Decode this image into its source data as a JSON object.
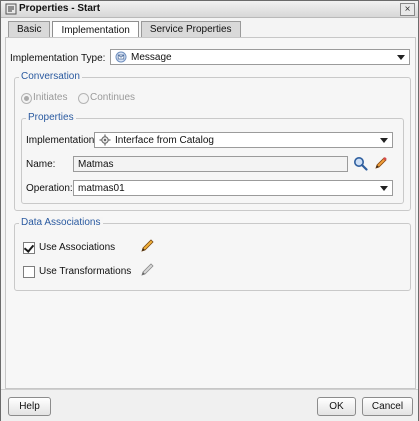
{
  "window": {
    "title": "Properties - Start",
    "close_label": "×"
  },
  "tabs": [
    {
      "label": "Basic",
      "active": false
    },
    {
      "label": "Implementation",
      "active": true
    },
    {
      "label": "Service Properties",
      "active": false
    }
  ],
  "implementation_type": {
    "label": "Implementation Type:",
    "value": "Message"
  },
  "conversation": {
    "title": "Conversation",
    "radio_initiates": "Initiates",
    "radio_continues": "Continues",
    "selected": "Initiates"
  },
  "properties": {
    "title": "Properties",
    "implementation_label": "Implementation:",
    "implementation_value": "Interface from Catalog",
    "name_label": "Name:",
    "name_value": "Matmas",
    "operation_label": "Operation:",
    "operation_value": "matmas01"
  },
  "data_associations": {
    "title": "Data Associations",
    "use_associations": {
      "label": "Use Associations",
      "checked": true
    },
    "use_transformations": {
      "label": "Use Transformations",
      "checked": false
    }
  },
  "footer": {
    "help": "Help",
    "ok": "OK",
    "cancel": "Cancel"
  },
  "icons": {
    "title": "properties-icon",
    "message": "message-icon",
    "interface": "gear-icon",
    "search": "search-icon",
    "edit": "pencil-icon"
  }
}
